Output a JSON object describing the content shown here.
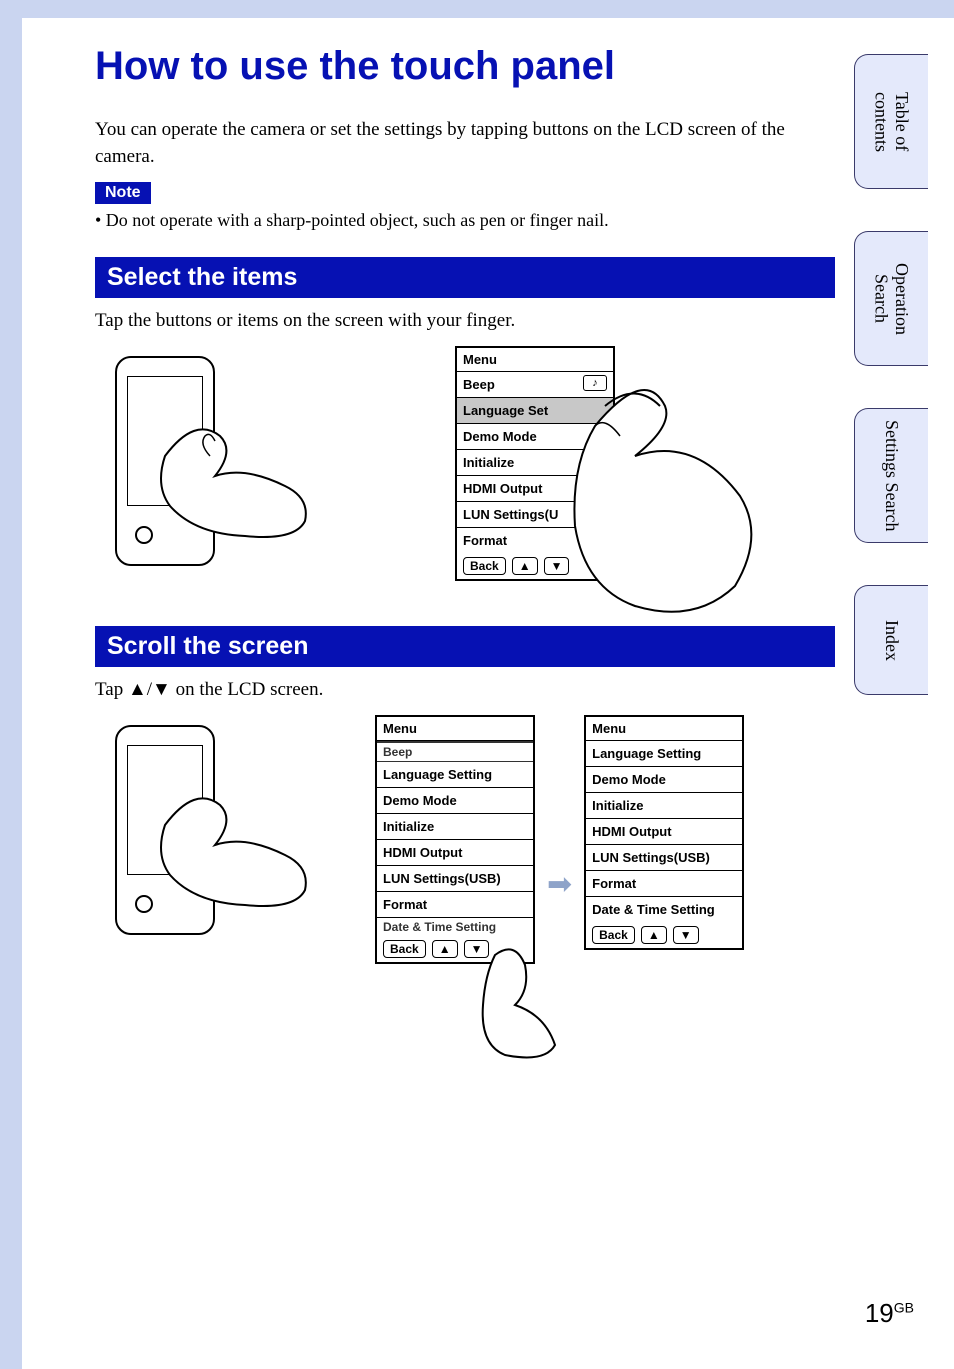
{
  "title": "How to use the touch panel",
  "intro": "You can operate the camera or set the settings by tapping buttons on the LCD screen of the camera.",
  "note_label": "Note",
  "note_text": "• Do not operate with a sharp-pointed object, such as pen or finger nail.",
  "section1": {
    "heading": "Select the items",
    "text": "Tap the buttons or items on the screen with your finger.",
    "menu": {
      "title": "Menu",
      "items": [
        "Beep",
        "Language Set",
        "Demo Mode",
        "Initialize",
        "HDMI Output",
        "LUN Settings(U",
        "Format"
      ],
      "highlighted_index": 1,
      "nav": {
        "back": "Back",
        "up": "▲",
        "down": "▼"
      }
    }
  },
  "section2": {
    "heading": "Scroll the screen",
    "text": "Tap ▲/▼ on the LCD screen.",
    "menu_before": {
      "title": "Menu",
      "partial_top": "Beep",
      "items": [
        "Language Setting",
        "Demo Mode",
        "Initialize",
        "HDMI Output",
        "LUN Settings(USB)",
        "Format"
      ],
      "partial_bot": "Date & Time Setting",
      "nav": {
        "back": "Back",
        "up": "▲",
        "down": "▼"
      }
    },
    "menu_after": {
      "title": "Menu",
      "items": [
        "Language Setting",
        "Demo Mode",
        "Initialize",
        "HDMI Output",
        "LUN Settings(USB)",
        "Format",
        "Date & Time Setting"
      ],
      "nav": {
        "back": "Back",
        "up": "▲",
        "down": "▼"
      }
    }
  },
  "side_tabs": [
    "Table of contents",
    "Operation Search",
    "Settings Search",
    "Index"
  ],
  "page_number": "19",
  "page_suffix": "GB"
}
